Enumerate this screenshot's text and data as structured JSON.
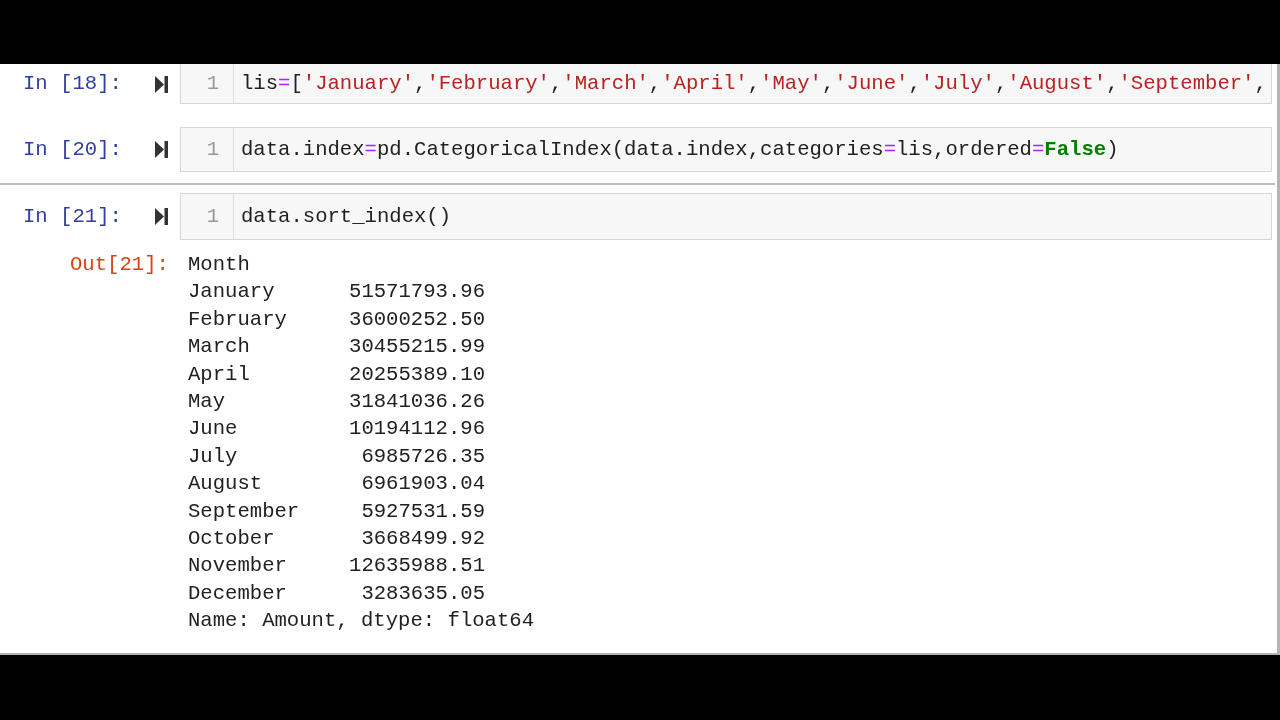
{
  "cells": [
    {
      "prompt": "In [18]:",
      "line_number": "1",
      "code": [
        {
          "kind": "plain",
          "text": "lis"
        },
        {
          "kind": "operator",
          "text": "="
        },
        {
          "kind": "plain",
          "text": "["
        },
        {
          "kind": "string",
          "text": "'January'"
        },
        {
          "kind": "plain",
          "text": ","
        },
        {
          "kind": "string",
          "text": "'February'"
        },
        {
          "kind": "plain",
          "text": ","
        },
        {
          "kind": "string",
          "text": "'March'"
        },
        {
          "kind": "plain",
          "text": ","
        },
        {
          "kind": "string",
          "text": "'April'"
        },
        {
          "kind": "plain",
          "text": ","
        },
        {
          "kind": "string",
          "text": "'May'"
        },
        {
          "kind": "plain",
          "text": ","
        },
        {
          "kind": "string",
          "text": "'June'"
        },
        {
          "kind": "plain",
          "text": ","
        },
        {
          "kind": "string",
          "text": "'July'"
        },
        {
          "kind": "plain",
          "text": ","
        },
        {
          "kind": "string",
          "text": "'August'"
        },
        {
          "kind": "plain",
          "text": ","
        },
        {
          "kind": "string",
          "text": "'September'"
        },
        {
          "kind": "plain",
          "text": ","
        }
      ]
    },
    {
      "prompt": "In [20]:",
      "line_number": "1",
      "code": [
        {
          "kind": "plain",
          "text": "data.index"
        },
        {
          "kind": "operator",
          "text": "="
        },
        {
          "kind": "plain",
          "text": "pd.CategoricalIndex(data.index,categories"
        },
        {
          "kind": "operator",
          "text": "="
        },
        {
          "kind": "plain",
          "text": "lis,ordered"
        },
        {
          "kind": "operator",
          "text": "="
        },
        {
          "kind": "keyword",
          "text": "False"
        },
        {
          "kind": "plain",
          "text": ")"
        }
      ]
    },
    {
      "prompt": "In [21]:",
      "line_number": "1",
      "code": [
        {
          "kind": "plain",
          "text": "data.sort_index()"
        }
      ]
    }
  ],
  "output": {
    "prompt": "Out[21]:",
    "index_name": "Month",
    "rows": [
      {
        "label": "January",
        "value": "51571793.96"
      },
      {
        "label": "February",
        "value": "36000252.50"
      },
      {
        "label": "March",
        "value": "30455215.99"
      },
      {
        "label": "April",
        "value": "20255389.10"
      },
      {
        "label": "May",
        "value": "31841036.26"
      },
      {
        "label": "June",
        "value": "10194112.96"
      },
      {
        "label": "July",
        "value": "6985726.35"
      },
      {
        "label": "August",
        "value": "6961903.04"
      },
      {
        "label": "September",
        "value": "5927531.59"
      },
      {
        "label": "October",
        "value": "3668499.92"
      },
      {
        "label": "November",
        "value": "12635988.51"
      },
      {
        "label": "December",
        "value": "3283635.05"
      }
    ],
    "footer": "Name: Amount, dtype: float64"
  }
}
